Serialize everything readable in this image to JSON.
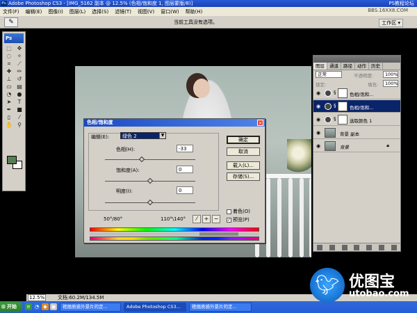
{
  "window": {
    "title": "Adobe Photoshop CS3 - [IMG_5162 副本 @ 12.5% (色相/饱和度 1, 图层蒙版/8)]",
    "ps_badge": "Ps",
    "top_watermark": "PS教程论坛"
  },
  "menu": {
    "items": [
      "文件(F)",
      "编辑(E)",
      "图像(I)",
      "图层(L)",
      "选择(S)",
      "滤镜(T)",
      "视图(V)",
      "窗口(W)",
      "帮助(H)"
    ],
    "site": "BBS.16XX8.COM"
  },
  "options_bar": {
    "hint": "当前工具没有选项。",
    "workspace": "工作区 ▾"
  },
  "toolbox": {
    "logo": "Ps",
    "fg_color": "#577f55",
    "bg_color": "#ffffff"
  },
  "dialog": {
    "title": "色相/饱和度",
    "edit_label": "编辑(E):",
    "edit_value": "绿色 2",
    "hue_label": "色相(H):",
    "hue_value": "-33",
    "sat_label": "饱和度(A):",
    "sat_value": "0",
    "light_label": "明度(I):",
    "light_value": "0",
    "range_left": "50°/80°",
    "range_right": "110°\\140°",
    "buttons": {
      "ok": "确定",
      "cancel": "取消",
      "load": "载入(L)...",
      "save": "存储(S)..."
    },
    "colorize_label": "着色(O)",
    "preview_label": "预览(P)",
    "hue_level": 0.41,
    "sat_level": 0.5,
    "light_level": 0.5
  },
  "layers_panel": {
    "tabs": [
      "图层",
      "通道",
      "路径",
      "动作",
      "历史"
    ],
    "blend_mode": "正常",
    "opacity_label": "不透明度:",
    "opacity_value": "100%",
    "lock_label": "锁定:",
    "fill_label": "填充:",
    "fill_value": "100%",
    "layers": [
      {
        "name": "色相/饱和...",
        "selected": false
      },
      {
        "name": "色相/饱和...",
        "selected": true
      },
      {
        "name": "选取颜色 1",
        "selected": false
      },
      {
        "name": "背景 副本",
        "selected": false
      },
      {
        "name": "背景",
        "selected": false
      }
    ]
  },
  "status": {
    "zoom": "12.5%",
    "doc": "文档:60.2M/134.5M"
  },
  "taskbar": {
    "start": "开始",
    "tasks": [
      "艳丽质感外景片的定...",
      "Adobe Photoshop CS3...",
      "艳丽质感外景片的定..."
    ]
  },
  "brand": {
    "cn": "优图宝",
    "en": "utobao.com"
  }
}
